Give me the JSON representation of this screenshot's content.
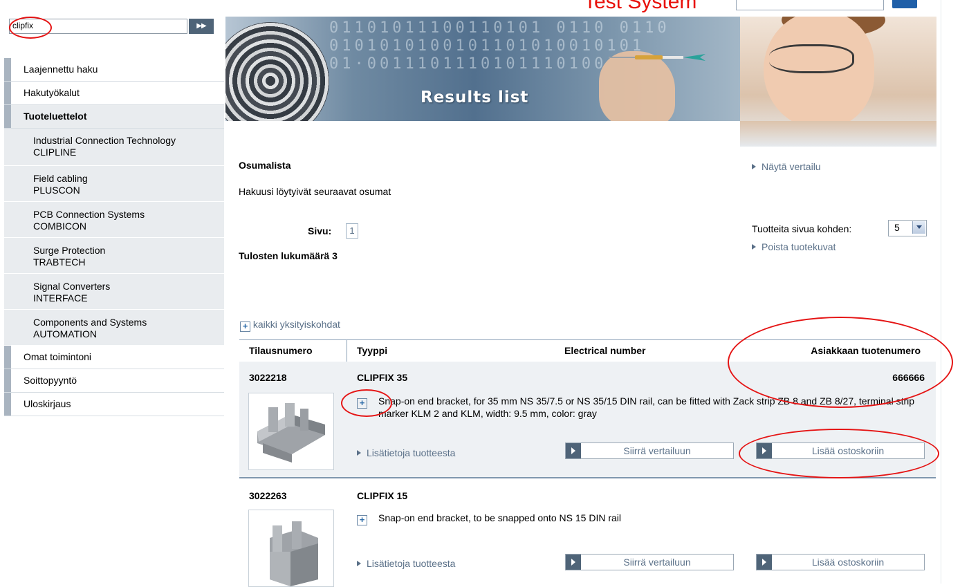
{
  "header": {
    "brand_text": "Test System"
  },
  "search": {
    "value": "clipfix",
    "go_label": "▶▶"
  },
  "sidebar": {
    "items": [
      {
        "label": "Laajennettu haku"
      },
      {
        "label": "Hakutyökalut"
      },
      {
        "label": "Tuoteluettelot"
      }
    ],
    "sub_items": [
      {
        "line1": "Industrial Connection Technology",
        "line2": "CLIPLINE"
      },
      {
        "line1": "Field cabling",
        "line2": "PLUSCON"
      },
      {
        "line1": "PCB Connection Systems",
        "line2": "COMBICON"
      },
      {
        "line1": "Surge Protection",
        "line2": "TRABTECH"
      },
      {
        "line1": "Signal Converters",
        "line2": "INTERFACE"
      },
      {
        "line1": "Components and Systems",
        "line2": "AUTOMATION"
      }
    ],
    "bottom_items": [
      {
        "label": "Omat toimintoni"
      },
      {
        "label": "Soittopyyntö"
      },
      {
        "label": "Uloskirjaus"
      }
    ]
  },
  "banner": {
    "title": "Results list",
    "digits": "01101011100110101 0110 0110\n0101010100101101010010101\n01·0011101110101110100"
  },
  "results": {
    "heading": "Osumalista",
    "intro": "Hakuusi löytyivät seuraavat osumat",
    "show_comparison": "Näytä vertailu",
    "page_label": "Sivu:",
    "page_number": "1",
    "count_label": "Tulosten lukumäärä 3",
    "per_page_label": "Tuotteita sivua kohden:",
    "per_page_value": "5",
    "remove_images": "Poista tuotekuvat",
    "all_details": "kaikki yksityiskohdat",
    "columns": {
      "order": "Tilausnumero",
      "type": "Tyyppi",
      "electrical": "Electrical number",
      "customer": "Asiakkaan tuotenumero"
    },
    "rows": [
      {
        "order": "3022218",
        "type": "CLIPFIX 35",
        "customer_number": "666666",
        "description": "Snap-on end bracket, for 35 mm NS 35/7.5 or NS 35/15 DIN rail, can be fitted with Zack strip ZB 8 and ZB 8/27, terminal strip marker KLM 2 and KLM, width: 9.5 mm, color: gray",
        "more_info": "Lisätietoja tuotteesta",
        "compare_btn": "Siirrä vertailuun",
        "cart_btn": "Lisää ostoskoriin"
      },
      {
        "order": "3022263",
        "type": "CLIPFIX 15",
        "customer_number": "",
        "description": "Snap-on end bracket, to be snapped onto NS 15 DIN rail",
        "more_info": "Lisätietoja tuotteesta",
        "compare_btn": "Siirrä vertailuun",
        "cart_btn": "Lisää ostoskoriin"
      }
    ]
  },
  "colors": {
    "annotation_red": "#e51515",
    "link_blue_gray": "#5a7088",
    "sidebar_marker": "#a9b4c0",
    "button_square": "#4f6478"
  }
}
